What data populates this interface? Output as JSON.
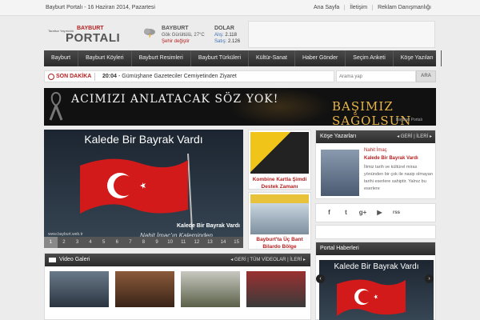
{
  "topbar": {
    "date": "Bayburt Portalı - 16 Haziran 2014, Pazartesi",
    "links": [
      "Ana Sayfa",
      "İletişim",
      "Reklam Danışmanlığı"
    ]
  },
  "logo": {
    "small": "Tarafsız Yayıncılık",
    "bayburt": "BAYBURT",
    "portal": "PORTALI"
  },
  "weather": {
    "city": "BAYBURT",
    "condition": "Gök Gürültülü, 27°C",
    "change": "Şehir değiştir",
    "icon": "storm-cloud-icon"
  },
  "currency": {
    "name": "DOLAR",
    "buy_label": "Alış:",
    "buy": "2.118",
    "sell_label": "Satış:",
    "sell": "2.126"
  },
  "nav": [
    "Bayburt",
    "Bayburt Köyleri",
    "Bayburt Resimleri",
    "Bayburt Türküleri",
    "Kültür-Sanat",
    "Haber Gönder",
    "Seçim Anketi",
    "Köşe Yazıları"
  ],
  "ticker": {
    "label": "SON DAKİKA",
    "time": "20:04",
    "text": "- Gümüşhane Gazeteciler Cemiyetinden Ziyaret"
  },
  "search": {
    "placeholder": "Arama yap",
    "button": "ARA"
  },
  "banner": {
    "left": "ACIMIZI ANLATACAK SÖZ YOK!",
    "right": "BAŞIMIZ SAĞOLSUN",
    "signature": "Bayburt Portalı"
  },
  "slider": {
    "heading": "Kalede Bir Bayrak Vardı",
    "caption": "Kalede Bir Bayrak Vardı",
    "subtitle": "Nahit İmaç'ın Kaleminden",
    "url": "www.bayburt.web.tr",
    "pages": [
      "1",
      "2",
      "3",
      "4",
      "5",
      "6",
      "7",
      "8",
      "9",
      "10",
      "11",
      "12",
      "13",
      "14",
      "15"
    ],
    "active_page": "1"
  },
  "promos": [
    {
      "caption": "Kombine Kartla Şimdi Destek Zamanı"
    },
    {
      "caption": "Bayburt'ta Üç Bant Bilardo Bölge"
    }
  ],
  "authors": {
    "title": "Köşe Yazarları",
    "controls": "◂ GERİ | İLERİ ▸",
    "name": "Nahit İmaç",
    "article": "Kalede Bir Bayrak Vardı",
    "excerpt": "İlimiz tarih ve kültürel miras yönünden bir çok ile nasip olmayan tarihi eserlere sahiptir. Yalnız bu eserlere"
  },
  "social": [
    "f",
    "t",
    "g+",
    "▶",
    "rss"
  ],
  "portal_news": {
    "title": "Portal Haberleri",
    "heading": "Kalede Bir Bayrak Vardı"
  },
  "video_gallery": {
    "title": "Video Galeri",
    "controls": "◂ GERİ | TÜM VİDEOLAR | İLERİ ▸"
  }
}
